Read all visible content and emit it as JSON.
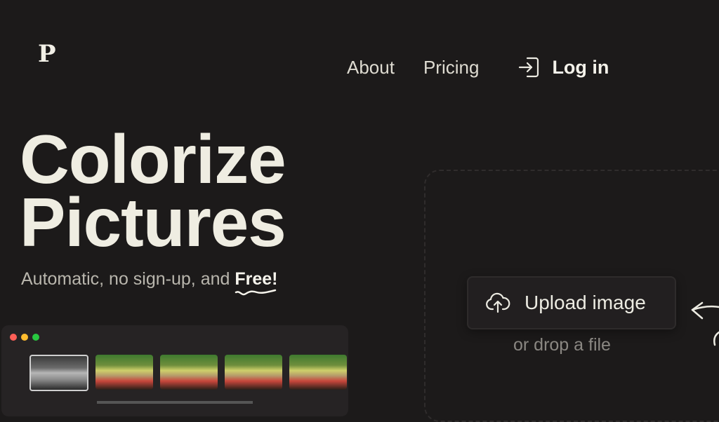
{
  "logo": {
    "letter": "P"
  },
  "nav": {
    "about": "About",
    "pricing": "Pricing",
    "login": "Log in",
    "login_icon": "login-icon"
  },
  "hero": {
    "title_line1": "Colorize",
    "title_line2": "Pictures",
    "subtitle": "Automatic, no sign-up, and ",
    "subtitle_emphasis": "Free!"
  },
  "preview": {
    "window_dots": [
      "#ff5f57",
      "#febc2e",
      "#28c840"
    ],
    "thumbnails": [
      "original",
      "colorized",
      "colorized",
      "colorized",
      "colorized"
    ]
  },
  "upload": {
    "button_label": "Upload image",
    "button_icon": "cloud-upload-icon",
    "hint": "or drop a file"
  },
  "colors": {
    "background": "#1c1a1a",
    "title": "#efede2",
    "muted": "#8a8782"
  }
}
